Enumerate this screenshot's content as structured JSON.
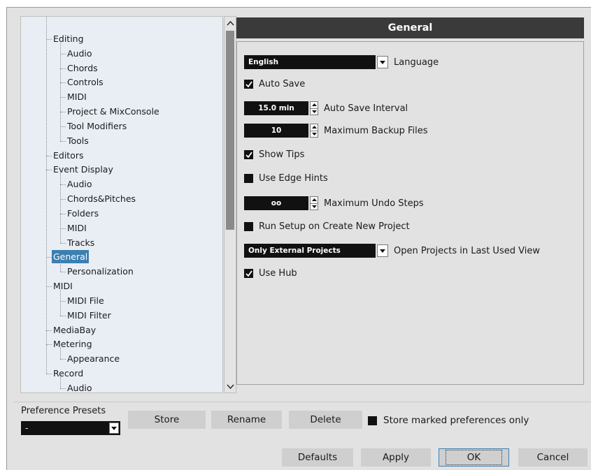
{
  "tree": {
    "items": [
      {
        "label": "Editing",
        "level": 1
      },
      {
        "label": "Audio",
        "level": 2
      },
      {
        "label": "Chords",
        "level": 2
      },
      {
        "label": "Controls",
        "level": 2
      },
      {
        "label": "MIDI",
        "level": 2
      },
      {
        "label": "Project & MixConsole",
        "level": 2
      },
      {
        "label": "Tool Modifiers",
        "level": 2
      },
      {
        "label": "Tools",
        "level": 2
      },
      {
        "label": "Editors",
        "level": 1
      },
      {
        "label": "Event Display",
        "level": 1
      },
      {
        "label": "Audio",
        "level": 2
      },
      {
        "label": "Chords&Pitches",
        "level": 2
      },
      {
        "label": "Folders",
        "level": 2
      },
      {
        "label": "MIDI",
        "level": 2
      },
      {
        "label": "Tracks",
        "level": 2
      },
      {
        "label": "General",
        "level": 1,
        "selected": true
      },
      {
        "label": "Personalization",
        "level": 2
      },
      {
        "label": "MIDI",
        "level": 1
      },
      {
        "label": "MIDI File",
        "level": 2
      },
      {
        "label": "MIDI Filter",
        "level": 2
      },
      {
        "label": "MediaBay",
        "level": 1
      },
      {
        "label": "Metering",
        "level": 1
      },
      {
        "label": "Appearance",
        "level": 2
      },
      {
        "label": "Record",
        "level": 1
      },
      {
        "label": "Audio",
        "level": 2
      }
    ]
  },
  "panel": {
    "title": "General",
    "language": {
      "value": "English",
      "label": "Language"
    },
    "auto_save": {
      "label": "Auto Save",
      "checked": true
    },
    "auto_save_interval": {
      "value": "15.0 min",
      "label": "Auto Save Interval"
    },
    "max_backup": {
      "value": "10",
      "label": "Maximum Backup Files"
    },
    "show_tips": {
      "label": "Show Tips",
      "checked": true
    },
    "edge_hints": {
      "label": "Use Edge Hints",
      "checked": false
    },
    "max_undo": {
      "value": "oo",
      "label": "Maximum Undo Steps"
    },
    "run_setup": {
      "label": "Run Setup on Create New Project",
      "checked": false
    },
    "open_projects": {
      "value": "Only External Projects",
      "label": "Open Projects in Last Used View"
    },
    "use_hub": {
      "label": "Use Hub",
      "checked": true
    }
  },
  "presets": {
    "label": "Preference Presets",
    "value": "-",
    "store": "Store",
    "rename": "Rename",
    "delete": "Delete",
    "marked_only": "Store marked preferences only"
  },
  "footer": {
    "defaults": "Defaults",
    "apply": "Apply",
    "ok": "OK",
    "cancel": "Cancel"
  },
  "colors": {
    "selection": "#3c7fb1",
    "header": "#3a3a3a",
    "control": "#111111"
  }
}
